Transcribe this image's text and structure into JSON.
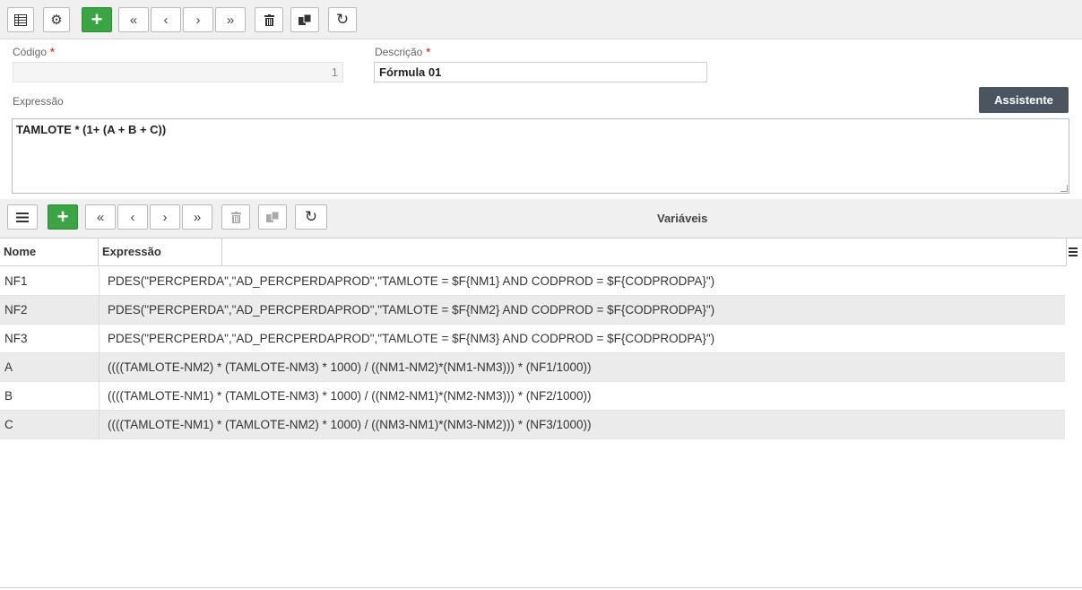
{
  "toolbar": {
    "icons": [
      "grid-icon",
      "gear-icon",
      "plus-icon",
      "first-icon",
      "prev-icon",
      "next-icon",
      "last-icon",
      "trash-icon",
      "copy-icon",
      "refresh-icon"
    ]
  },
  "form": {
    "codigo_label": "Código",
    "codigo_value": "1",
    "descricao_label": "Descrição",
    "descricao_value": "Fórmula 01",
    "required_mark": "*",
    "expressao_label": "Expressão",
    "assistente_label": "Assistente",
    "expressao_value": "TAMLOTE * (1+ (A + B + C))"
  },
  "variaveis": {
    "title": "Variáveis",
    "columns": [
      "Nome",
      "Expressão"
    ],
    "rows": [
      {
        "nome": "NF1",
        "expressao": "PDES(\"PERCPERDA\",\"AD_PERCPERDAPROD\",\"TAMLOTE = $F{NM1} AND CODPROD = $F{CODPRODPA}\")"
      },
      {
        "nome": "NF2",
        "expressao": "PDES(\"PERCPERDA\",\"AD_PERCPERDAPROD\",\"TAMLOTE = $F{NM2} AND CODPROD = $F{CODPRODPA}\")"
      },
      {
        "nome": "NF3",
        "expressao": "PDES(\"PERCPERDA\",\"AD_PERCPERDAPROD\",\"TAMLOTE = $F{NM3} AND CODPROD = $F{CODPRODPA}\")"
      },
      {
        "nome": "A",
        "expressao": "((((TAMLOTE-NM2) * (TAMLOTE-NM3) * 1000) / ((NM1-NM2)*(NM1-NM3))) * (NF1/1000))"
      },
      {
        "nome": "B",
        "expressao": "((((TAMLOTE-NM1) * (TAMLOTE-NM3) * 1000) / ((NM2-NM1)*(NM2-NM3))) * (NF2/1000))"
      },
      {
        "nome": "C",
        "expressao": "((((TAMLOTE-NM1) * (TAMLOTE-NM2) * 1000) / ((NM3-NM1)*(NM3-NM2))) * (NF3/1000))"
      }
    ]
  },
  "colors": {
    "green_button": "#3aa543",
    "dark_button": "#4a5561",
    "required": "#e03c31"
  }
}
